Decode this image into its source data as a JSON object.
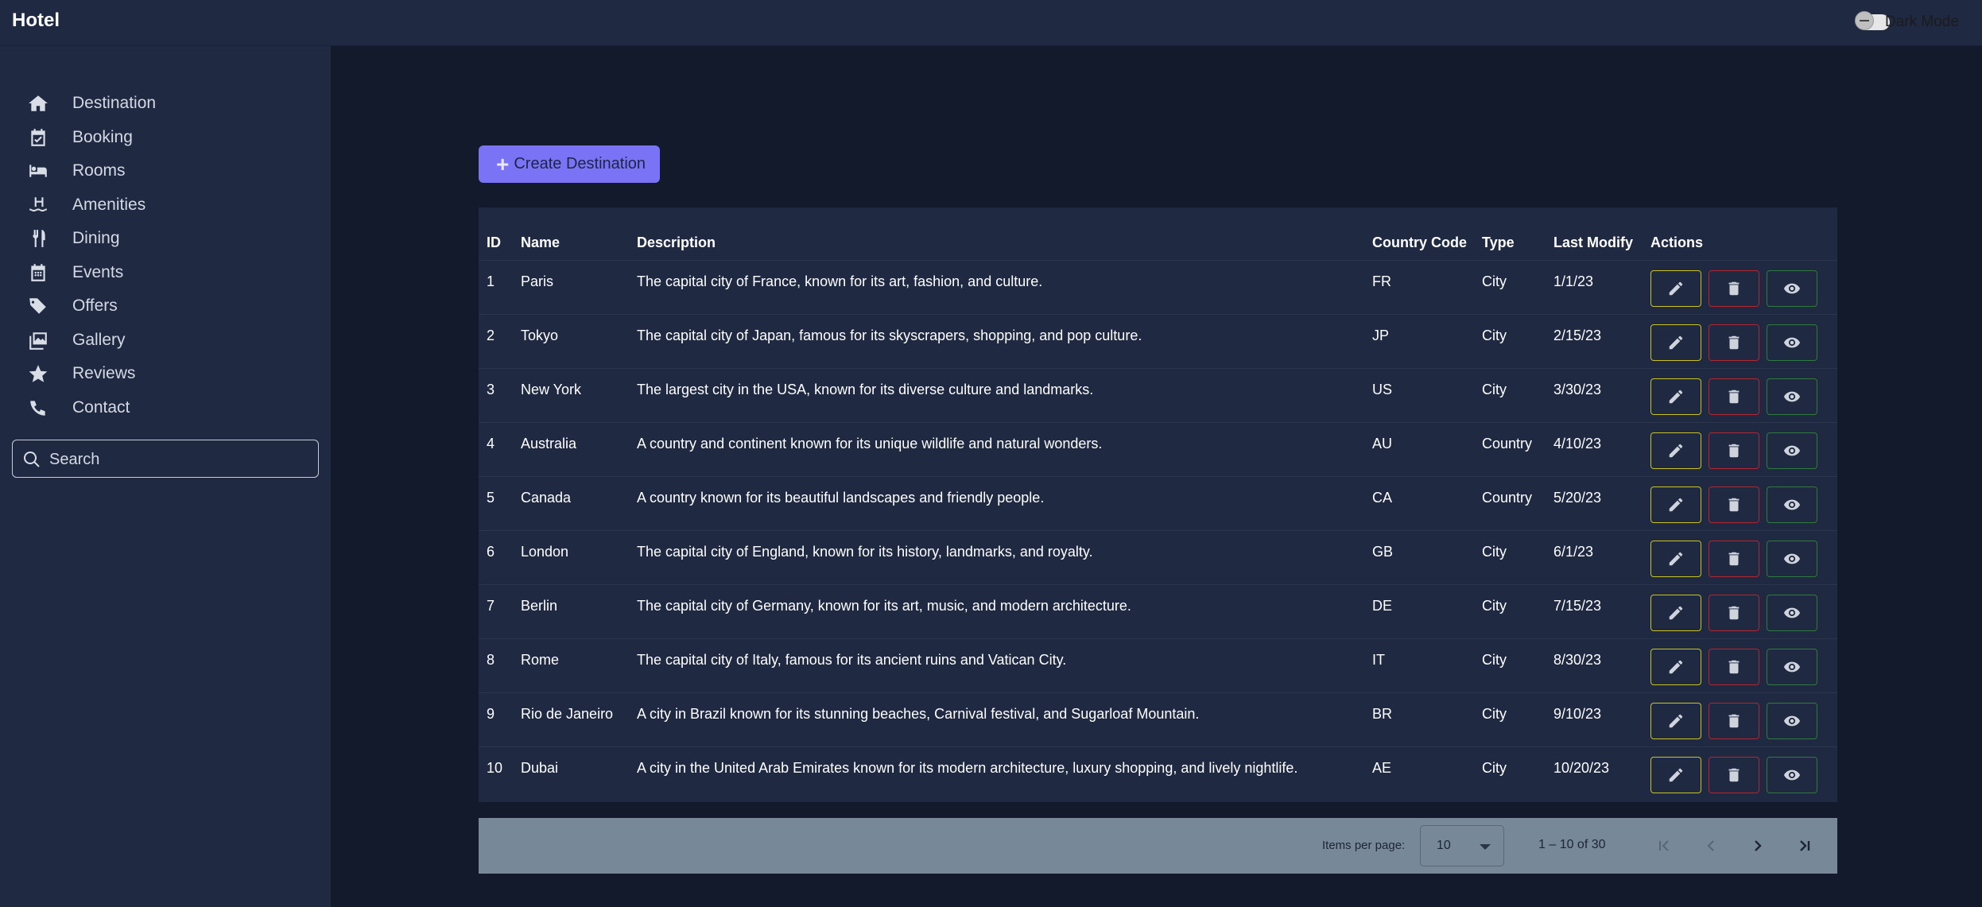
{
  "header": {
    "title": "Hotel",
    "dark_mode_label": "Dark Mode"
  },
  "sidebar": {
    "items": [
      {
        "label": "Destination",
        "icon": "home-icon"
      },
      {
        "label": "Booking",
        "icon": "calendar-check-icon"
      },
      {
        "label": "Rooms",
        "icon": "bed-icon"
      },
      {
        "label": "Amenities",
        "icon": "pool-icon"
      },
      {
        "label": "Dining",
        "icon": "utensils-icon"
      },
      {
        "label": "Events",
        "icon": "calendar-icon"
      },
      {
        "label": "Offers",
        "icon": "tags-icon"
      },
      {
        "label": "Gallery",
        "icon": "images-icon"
      },
      {
        "label": "Reviews",
        "icon": "star-icon"
      },
      {
        "label": "Contact",
        "icon": "phone-icon"
      }
    ],
    "search": {
      "placeholder": "Search"
    }
  },
  "main": {
    "create_button_label": "Create Destination",
    "table": {
      "headers": [
        "ID",
        "Name",
        "Description",
        "Country Code",
        "Type",
        "Last Modify",
        "Actions"
      ],
      "rows": [
        {
          "id": "1",
          "name": "Paris",
          "description": "The capital city of France, known for its art, fashion, and culture.",
          "code": "FR",
          "type": "City",
          "modified": "1/1/23"
        },
        {
          "id": "2",
          "name": "Tokyo",
          "description": "The capital city of Japan, famous for its skyscrapers, shopping, and pop culture.",
          "code": "JP",
          "type": "City",
          "modified": "2/15/23"
        },
        {
          "id": "3",
          "name": "New York",
          "description": "The largest city in the USA, known for its diverse culture and landmarks.",
          "code": "US",
          "type": "City",
          "modified": "3/30/23"
        },
        {
          "id": "4",
          "name": "Australia",
          "description": "A country and continent known for its unique wildlife and natural wonders.",
          "code": "AU",
          "type": "Country",
          "modified": "4/10/23"
        },
        {
          "id": "5",
          "name": "Canada",
          "description": "A country known for its beautiful landscapes and friendly people.",
          "code": "CA",
          "type": "Country",
          "modified": "5/20/23"
        },
        {
          "id": "6",
          "name": "London",
          "description": "The capital city of England, known for its history, landmarks, and royalty.",
          "code": "GB",
          "type": "City",
          "modified": "6/1/23"
        },
        {
          "id": "7",
          "name": "Berlin",
          "description": "The capital city of Germany, known for its art, music, and modern architecture.",
          "code": "DE",
          "type": "City",
          "modified": "7/15/23"
        },
        {
          "id": "8",
          "name": "Rome",
          "description": "The capital city of Italy, famous for its ancient ruins and Vatican City.",
          "code": "IT",
          "type": "City",
          "modified": "8/30/23"
        },
        {
          "id": "9",
          "name": "Rio de Janeiro",
          "description": "A city in Brazil known for its stunning beaches, Carnival festival, and Sugarloaf Mountain.",
          "code": "BR",
          "type": "City",
          "modified": "9/10/23"
        },
        {
          "id": "10",
          "name": "Dubai",
          "description": "A city in the United Arab Emirates known for its modern architecture, luxury shopping, and lively nightlife.",
          "code": "AE",
          "type": "City",
          "modified": "10/20/23"
        }
      ],
      "action_icons": [
        "pencil-icon",
        "trash-icon",
        "eye-icon"
      ]
    },
    "paginator": {
      "items_per_page_label": "Items per page:",
      "items_per_page_value": "10",
      "range_label": "1 – 10 of 30"
    }
  },
  "colors": {
    "accent": "#7a73f5",
    "edit_border": "#c9c21f",
    "delete_border": "#b3262f",
    "view_border": "#2f7a3d",
    "paginator_bg": "#778899"
  }
}
